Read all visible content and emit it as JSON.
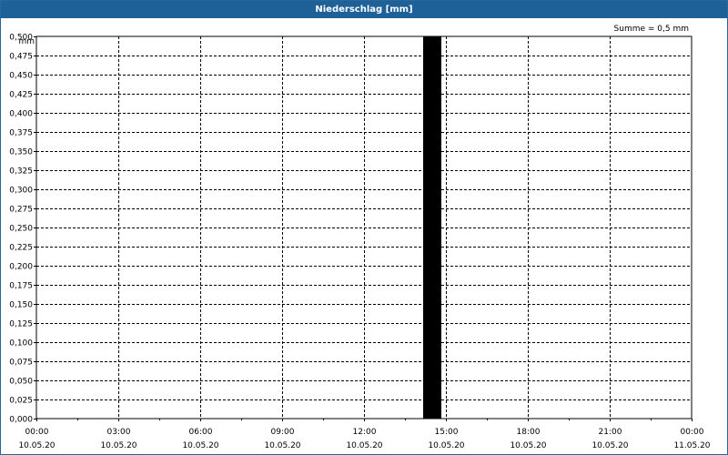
{
  "title": "Niederschlag [mm]",
  "colors": {
    "title_bar": "#1e6199",
    "bar": "#000000",
    "grid": "#000000"
  },
  "chart_data": {
    "type": "bar",
    "title": "Niederschlag [mm]",
    "annotation": "Summe = 0,5 mm",
    "ylabel": "mm",
    "xlabel": "",
    "ylim": [
      0,
      0.5
    ],
    "y_ticks": [
      "0,000",
      "0,025",
      "0,050",
      "0,075",
      "0,100",
      "0,125",
      "0,150",
      "0,175",
      "0,200",
      "0,225",
      "0,250",
      "0,275",
      "0,300",
      "0,325",
      "0,350",
      "0,375",
      "0,400",
      "0,425",
      "0,450",
      "0,475",
      "0,500"
    ],
    "x_range": [
      "10.05.20 00:00",
      "11.05.20 00:00"
    ],
    "x_ticks": [
      {
        "time": "00:00",
        "date": "10.05.20"
      },
      {
        "time": "03:00",
        "date": "10.05.20"
      },
      {
        "time": "06:00",
        "date": "10.05.20"
      },
      {
        "time": "09:00",
        "date": "10.05.20"
      },
      {
        "time": "12:00",
        "date": "10.05.20"
      },
      {
        "time": "15:00",
        "date": "10.05.20"
      },
      {
        "time": "18:00",
        "date": "10.05.20"
      },
      {
        "time": "21:00",
        "date": "10.05.20"
      },
      {
        "time": "00:00",
        "date": "11.05.20"
      }
    ],
    "grid": true,
    "bars": [
      {
        "start": "10.05.20 14:10",
        "end": "10.05.20 14:50",
        "value": 0.5
      }
    ]
  }
}
